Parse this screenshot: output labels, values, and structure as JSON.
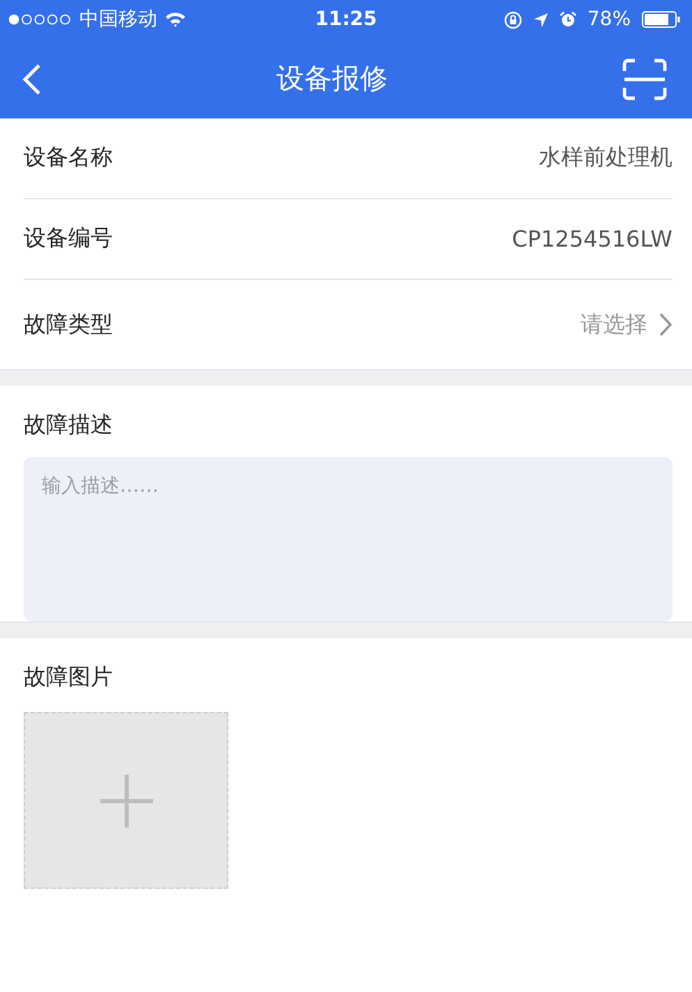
{
  "status_bar": {
    "carrier": "中国移动",
    "time": "11:25",
    "battery": "78%"
  },
  "nav_bar": {
    "title": "设备报修"
  },
  "fields": [
    {
      "kind": "value",
      "label": "设备名称",
      "value": "水样前处理机"
    },
    {
      "kind": "value",
      "label": "设备编号",
      "value": "CP1254516LW"
    },
    {
      "kind": "select",
      "label": "故障类型",
      "placeholder": "请选择"
    }
  ],
  "description": {
    "label": "故障描述",
    "placeholder": "输入描述……"
  },
  "photos": {
    "label": "故障图片"
  }
}
